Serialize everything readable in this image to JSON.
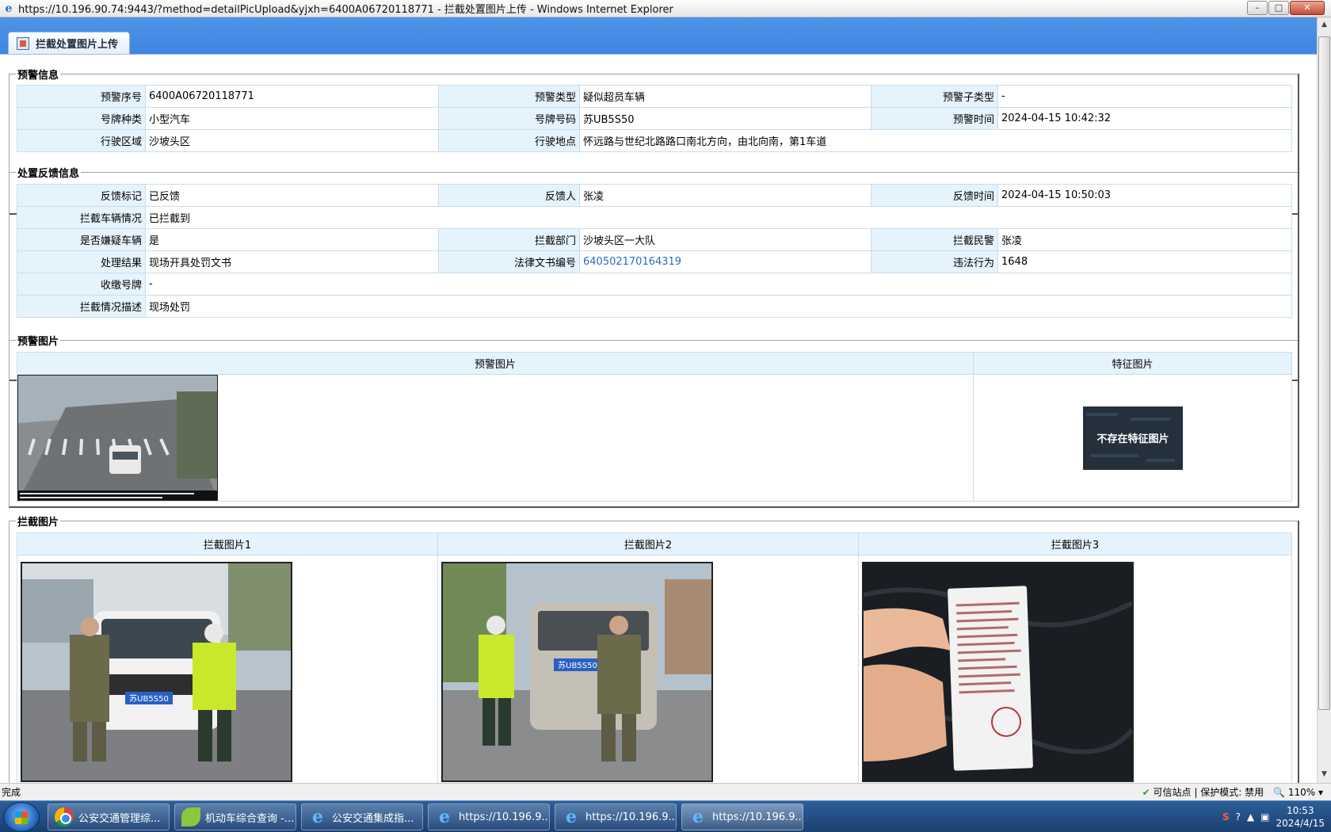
{
  "window": {
    "title": "https://10.196.90.74:9443/?method=detailPicUpload&yjxh=6400A06720118771 - 拦截处置图片上传 - Windows Internet Explorer",
    "min": "–",
    "max": "□",
    "close": "✕"
  },
  "tab": {
    "label": "拦截处置图片上传"
  },
  "alert_info": {
    "legend": "预警信息",
    "rows": [
      [
        {
          "l": "预警序号",
          "v": "6400A06720118771"
        },
        {
          "l": "预警类型",
          "v": "疑似超员车辆"
        },
        {
          "l": "预警子类型",
          "v": "-"
        }
      ],
      [
        {
          "l": "号牌种类",
          "v": "小型汽车"
        },
        {
          "l": "号牌号码",
          "v": "苏UB5S50"
        },
        {
          "l": "预警时间",
          "v": "2024-04-15 10:42:32"
        }
      ],
      [
        {
          "l": "行驶区域",
          "v": "沙坡头区"
        },
        {
          "l": "行驶地点",
          "v": "怀远路与世纪北路路口南北方向，由北向南，第1车道"
        }
      ]
    ]
  },
  "feedback_info": {
    "legend": "处置反馈信息",
    "rows": [
      [
        {
          "l": "反馈标记",
          "v": "已反馈"
        },
        {
          "l": "反馈人",
          "v": "张凌"
        },
        {
          "l": "反馈时间",
          "v": "2024-04-15 10:50:03"
        }
      ],
      [
        {
          "l": "拦截车辆情况",
          "v": "已拦截到"
        }
      ],
      [
        {
          "l": "是否嫌疑车辆",
          "v": "是"
        },
        {
          "l": "拦截部门",
          "v": "沙坡头区一大队"
        },
        {
          "l": "拦截民警",
          "v": "张凌"
        }
      ],
      [
        {
          "l": "处理结果",
          "v": "现场开具处罚文书"
        },
        {
          "l": "法律文书编号",
          "v": "640502170164319"
        },
        {
          "l": "违法行为",
          "v": "1648"
        }
      ],
      [
        {
          "l": "收缴号牌",
          "v": "-"
        }
      ],
      [
        {
          "l": "拦截情况描述",
          "v": "现场处罚"
        }
      ]
    ]
  },
  "alert_pics": {
    "legend": "预警图片",
    "col1": "预警图片",
    "col2": "特征图片",
    "no_feature": "不存在特征图片"
  },
  "intercept_pics": {
    "legend": "拦截图片",
    "cols": [
      "拦截图片1",
      "拦截图片2",
      "拦截图片3"
    ],
    "plate": "苏UB5S50"
  },
  "status": {
    "text": "完成",
    "trusted": "可信站点 | 保护模式: 禁用",
    "zoom": "110%"
  },
  "taskbar": {
    "items": [
      "公安交通管理综...",
      "机动车综合查询 -...",
      "公安交通集成指...",
      "https://10.196.9...",
      "https://10.196.9...",
      "https://10.196.9..."
    ],
    "time": "10:53",
    "date": "2024/4/15"
  }
}
